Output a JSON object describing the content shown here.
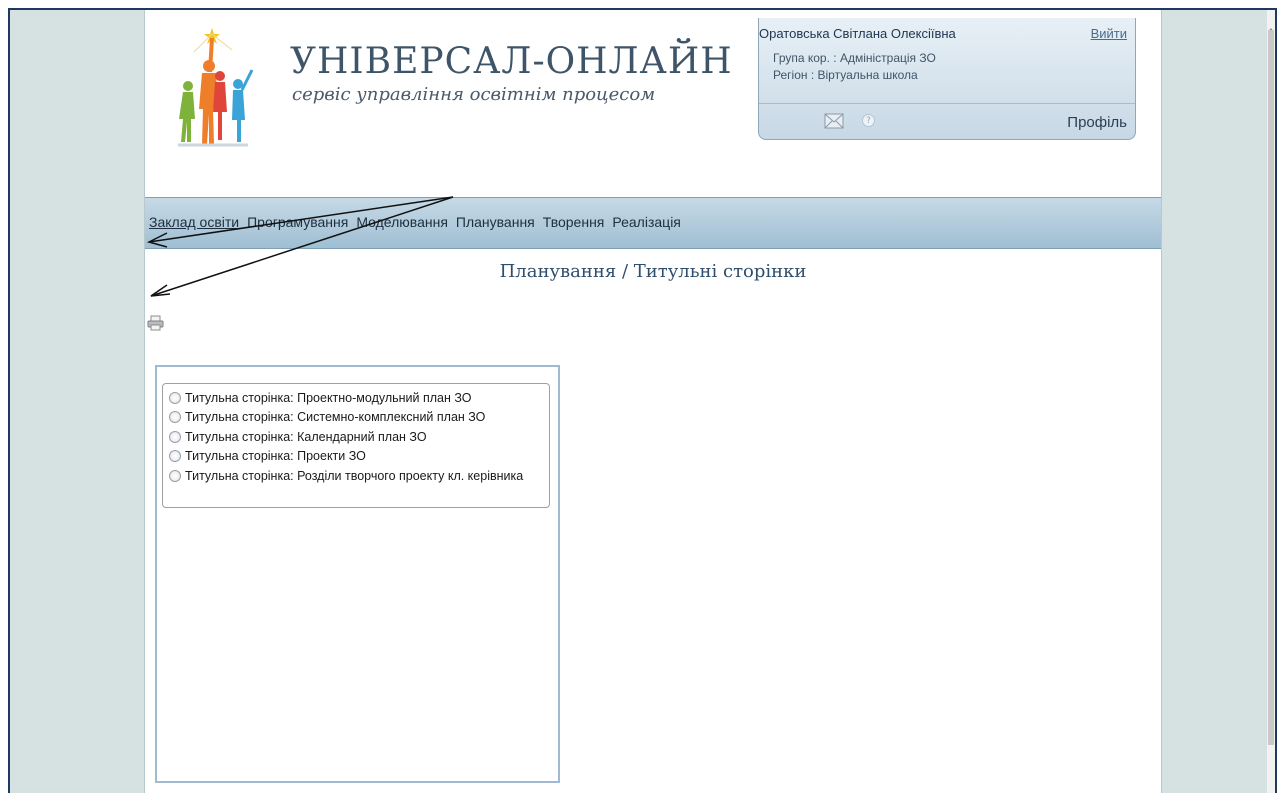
{
  "header": {
    "logo_title": "УНІВЕРСАЛ-ОНЛАЙН",
    "logo_subtitle": "сервіс управління освітнім процесом"
  },
  "user_panel": {
    "name": "Оратовська Світлана Олексіївна",
    "logout_label": "Вийти",
    "group_line": "Група кор. : Адміністрація ЗО",
    "region_line": "Регіон : Віртуальна школа",
    "help_glyph": "?",
    "profile_label": "Профіль"
  },
  "nav": {
    "items": [
      {
        "label": "Заклад освіти"
      },
      {
        "label": "Програмування"
      },
      {
        "label": "Моделювання"
      },
      {
        "label": "Планування"
      },
      {
        "label": "Творення"
      },
      {
        "label": "Реалізація"
      }
    ]
  },
  "main": {
    "heading": "Планування / Титульні сторінки",
    "options": [
      {
        "label": "Титульна сторінка: Проектно-модульний план ЗО"
      },
      {
        "label": "Титульна сторінка: Системно-комплексний план ЗО"
      },
      {
        "label": "Титульна сторінка: Календарний план ЗО"
      },
      {
        "label": "Титульна сторінка: Проекти ЗО"
      },
      {
        "label": "Титульна сторінка: Розділи творчого проекту кл. керівника"
      }
    ]
  },
  "icons": {
    "mail": "mail-icon",
    "help": "help-icon",
    "print": "printer-icon",
    "logo": "family-logo-icon"
  },
  "colors": {
    "nav_bar": "#b4cdde",
    "heading": "#2f4e6c",
    "page_background": "#d6e1e2",
    "frame_border": "#1f3a60"
  }
}
